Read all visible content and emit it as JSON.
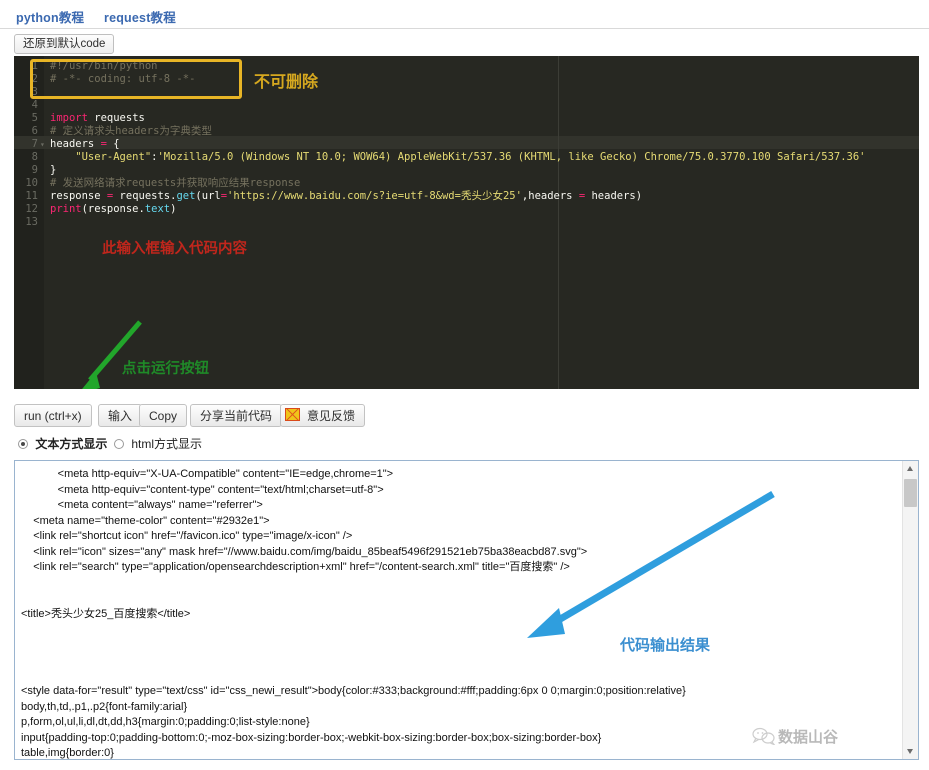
{
  "tabs": [
    {
      "label": "python教程"
    },
    {
      "label": "request教程"
    }
  ],
  "restore_button": {
    "label": "还原到默认code"
  },
  "editor": {
    "theme_bg": "#272822",
    "gutter_bg": "#21221d",
    "lines": [
      {
        "num": "1",
        "fold": "",
        "segments": [
          {
            "text": "#!/usr/bin/python",
            "cls": "c-com"
          }
        ]
      },
      {
        "num": "2",
        "fold": "",
        "segments": [
          {
            "text": "# -*- coding: utf-8 -*-",
            "cls": "c-com"
          }
        ]
      },
      {
        "num": "3",
        "fold": "",
        "segments": [
          {
            "text": "",
            "cls": "c-plain"
          }
        ]
      },
      {
        "num": "4",
        "fold": "",
        "segments": [
          {
            "text": "",
            "cls": "c-plain"
          }
        ]
      },
      {
        "num": "5",
        "fold": "",
        "segments": [
          {
            "text": "import",
            "cls": "c-kw"
          },
          {
            "text": " requests",
            "cls": "c-plain"
          }
        ]
      },
      {
        "num": "6",
        "fold": "",
        "segments": [
          {
            "text": "# 定义请求头headers为字典类型",
            "cls": "c-com"
          }
        ]
      },
      {
        "num": "7",
        "fold": "▾",
        "segments": [
          {
            "text": "headers ",
            "cls": "c-plain"
          },
          {
            "text": "=",
            "cls": "c-op"
          },
          {
            "text": " {",
            "cls": "c-plain"
          }
        ]
      },
      {
        "num": "8",
        "fold": "",
        "segments": [
          {
            "text": "    \"User-Agent\"",
            "cls": "c-str"
          },
          {
            "text": ":",
            "cls": "c-plain"
          },
          {
            "text": "'Mozilla/5.0 (Windows NT 10.0; WOW64) AppleWebKit/537.36 (KHTML, like Gecko) Chrome/75.0.3770.100 Safari/537.36'",
            "cls": "c-str"
          }
        ]
      },
      {
        "num": "9",
        "fold": "",
        "segments": [
          {
            "text": "}",
            "cls": "c-plain"
          }
        ]
      },
      {
        "num": "10",
        "fold": "",
        "segments": [
          {
            "text": "# 发送网络请求requests并获取响应结果response",
            "cls": "c-com"
          }
        ]
      },
      {
        "num": "11",
        "fold": "",
        "segments": [
          {
            "text": "response ",
            "cls": "c-plain"
          },
          {
            "text": "=",
            "cls": "c-op"
          },
          {
            "text": " requests.",
            "cls": "c-plain"
          },
          {
            "text": "get",
            "cls": "c-fn"
          },
          {
            "text": "(url",
            "cls": "c-plain"
          },
          {
            "text": "=",
            "cls": "c-op"
          },
          {
            "text": "'https://www.baidu.com/s?ie=utf-8&wd=秃头少女25'",
            "cls": "c-str"
          },
          {
            "text": ",headers ",
            "cls": "c-plain"
          },
          {
            "text": "=",
            "cls": "c-op"
          },
          {
            "text": " headers)",
            "cls": "c-plain"
          }
        ]
      },
      {
        "num": "12",
        "fold": "",
        "segments": [
          {
            "text": "print",
            "cls": "c-kw"
          },
          {
            "text": "(response.",
            "cls": "c-plain"
          },
          {
            "text": "text",
            "cls": "c-fn"
          },
          {
            "text": ")",
            "cls": "c-plain"
          }
        ]
      },
      {
        "num": "13",
        "fold": "",
        "segments": [
          {
            "text": "",
            "cls": "c-plain"
          }
        ]
      }
    ]
  },
  "annotations": {
    "no_delete": {
      "text": "不可删除",
      "color": "#d6a81f"
    },
    "input_code_here": {
      "text": "此输入框输入代码内容",
      "color": "#c0261c"
    },
    "click_run": {
      "text": "点击运行按钮",
      "color": "#1f8a28"
    },
    "code_output": {
      "text": "代码输出结果",
      "color": "#3b8fd0"
    }
  },
  "toolbar": {
    "run_label": "run (ctrl+x)",
    "input_label": "输入",
    "copy_label": "Copy",
    "share_label": "分享当前代码",
    "feedback_label": "意见反馈",
    "feedback_icon": "mail-icon"
  },
  "display_mode": {
    "text_mode": {
      "label": "文本方式显示",
      "selected": true
    },
    "html_mode": {
      "label": "html方式显示",
      "selected": false
    }
  },
  "output": {
    "content": "            <meta http-equiv=\"X-UA-Compatible\" content=\"IE=edge,chrome=1\">\n            <meta http-equiv=\"content-type\" content=\"text/html;charset=utf-8\">\n            <meta content=\"always\" name=\"referrer\">\n    <meta name=\"theme-color\" content=\"#2932e1\">\n    <link rel=\"shortcut icon\" href=\"/favicon.ico\" type=\"image/x-icon\" />\n    <link rel=\"icon\" sizes=\"any\" mask href=\"//www.baidu.com/img/baidu_85beaf5496f291521eb75ba38eacbd87.svg\">\n    <link rel=\"search\" type=\"application/opensearchdescription+xml\" href=\"/content-search.xml\" title=\"百度搜索\" />\n\n\n<title>秃头少女25_百度搜索</title>\n\n\n\n\n<style data-for=\"result\" type=\"text/css\" id=\"css_newi_result\">body{color:#333;background:#fff;padding:6px 0 0;margin:0;position:relative}\nbody,th,td,.p1,.p2{font-family:arial}\np,form,ol,ul,li,dl,dt,dd,h3{margin:0;padding:0;list-style:none}\ninput{padding-top:0;padding-bottom:0;-moz-box-sizing:border-box;-webkit-box-sizing:border-box;box-sizing:border-box}\ntable,img{border:0}"
  },
  "scrollbar": {
    "up_icon": "triangle-up-icon",
    "down_icon": "triangle-down-icon"
  },
  "watermark": {
    "text": "数据山谷",
    "icon": "wechat-icon"
  }
}
